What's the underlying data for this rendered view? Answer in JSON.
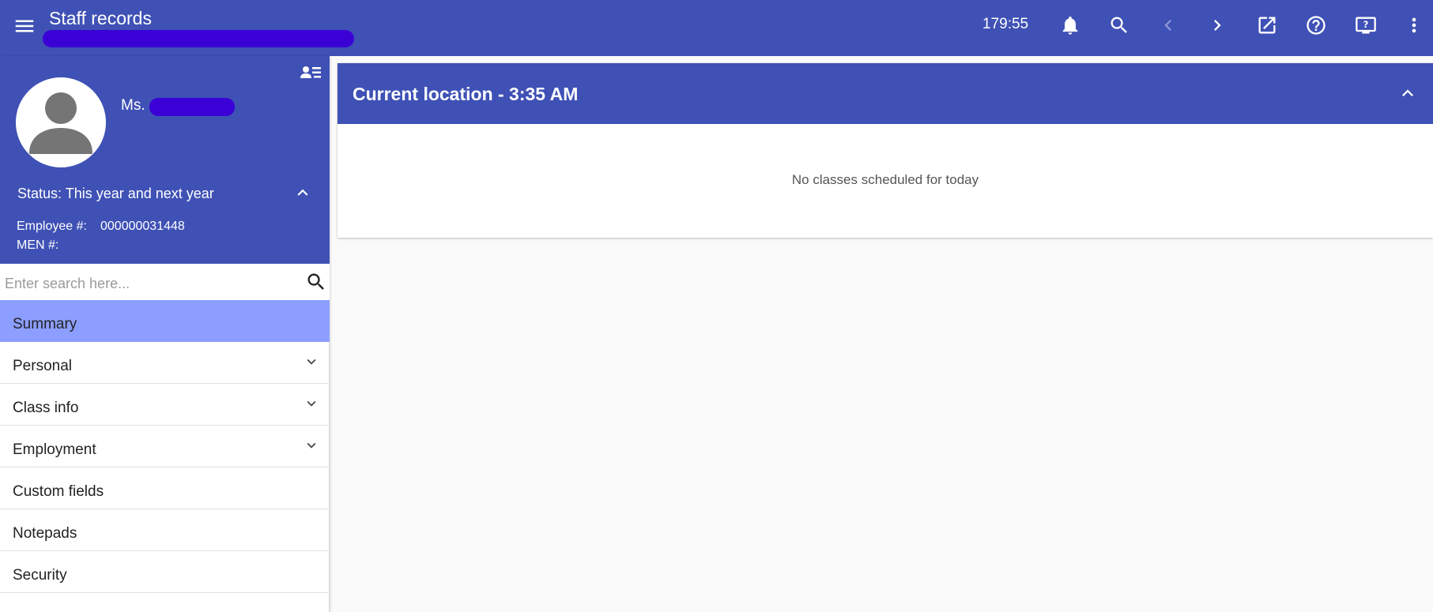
{
  "header": {
    "title": "Staff records",
    "timer": "179:55",
    "icons": [
      "menu-icon",
      "bell-icon",
      "search-icon",
      "chevron-left-icon",
      "chevron-right-icon",
      "open-in-new-icon",
      "help-icon",
      "screen-help-icon",
      "more-vert-icon"
    ]
  },
  "profile": {
    "name_prefix": "Ms.",
    "status_label": "Status: This year and next year",
    "employee_label": "Employee #:",
    "employee_number": "000000031448",
    "men_label": "MEN #:"
  },
  "search": {
    "placeholder": "Enter search here..."
  },
  "nav": {
    "items": [
      {
        "label": "Summary",
        "active": true,
        "expandable": false
      },
      {
        "label": "Personal",
        "active": false,
        "expandable": true
      },
      {
        "label": "Class info",
        "active": false,
        "expandable": true
      },
      {
        "label": "Employment",
        "active": false,
        "expandable": true
      },
      {
        "label": "Custom fields",
        "active": false,
        "expandable": false
      },
      {
        "label": "Notepads",
        "active": false,
        "expandable": false
      },
      {
        "label": "Security",
        "active": false,
        "expandable": false
      }
    ]
  },
  "panel": {
    "title": "Current location - 3:35 AM",
    "empty_message": "No classes scheduled for today"
  },
  "colors": {
    "primary": "#3f51b5",
    "active_nav": "#8c9eff",
    "redaction": "#3a00d6",
    "background": "#fafafa"
  }
}
